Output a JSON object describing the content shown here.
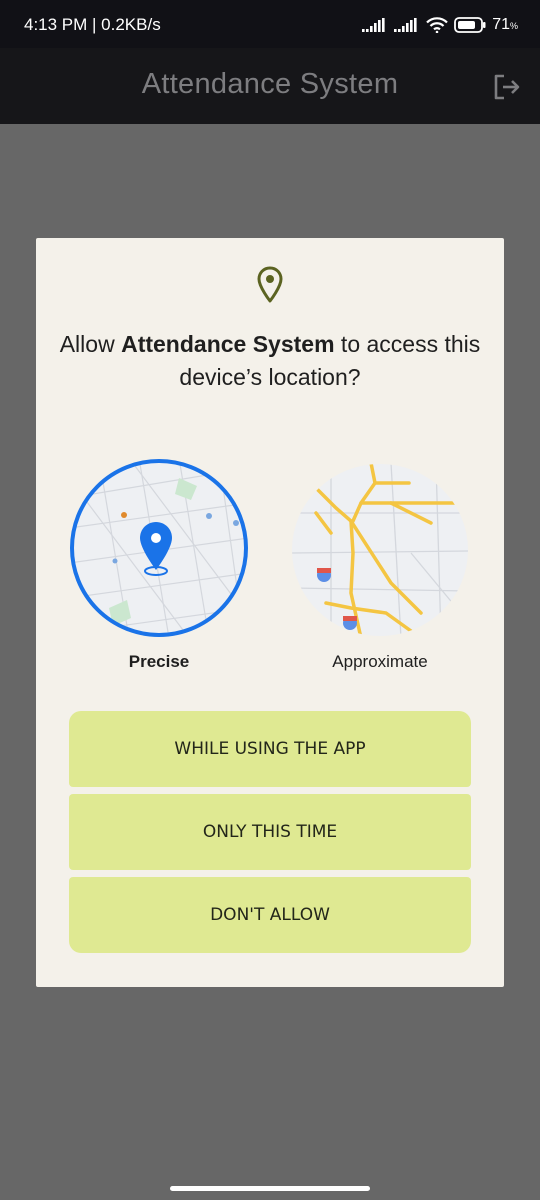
{
  "status_bar": {
    "time": "4:13 PM | 0.2KB/s",
    "battery": "71",
    "battery_unit": "%"
  },
  "app_bar": {
    "title": "Attendance System",
    "action_icon": "logout-icon"
  },
  "dialog": {
    "icon": "location-pin-icon",
    "title_prefix": "Allow ",
    "title_app": "Attendance System",
    "title_suffix": " to access this device’s location?",
    "options": {
      "precise_label": "Precise",
      "approximate_label": "Approximate",
      "selected": "precise"
    },
    "buttons": {
      "while_using": "WHILE USING THE APP",
      "only_this_time": "ONLY THIS TIME",
      "dont_allow": "DON'T ALLOW"
    }
  },
  "colors": {
    "accent_blue": "#1a73e8",
    "button_bg": "#dfe992",
    "dialog_bg": "#f4f1ea",
    "scrim": "#676767",
    "pin_olive": "#5b6321"
  }
}
